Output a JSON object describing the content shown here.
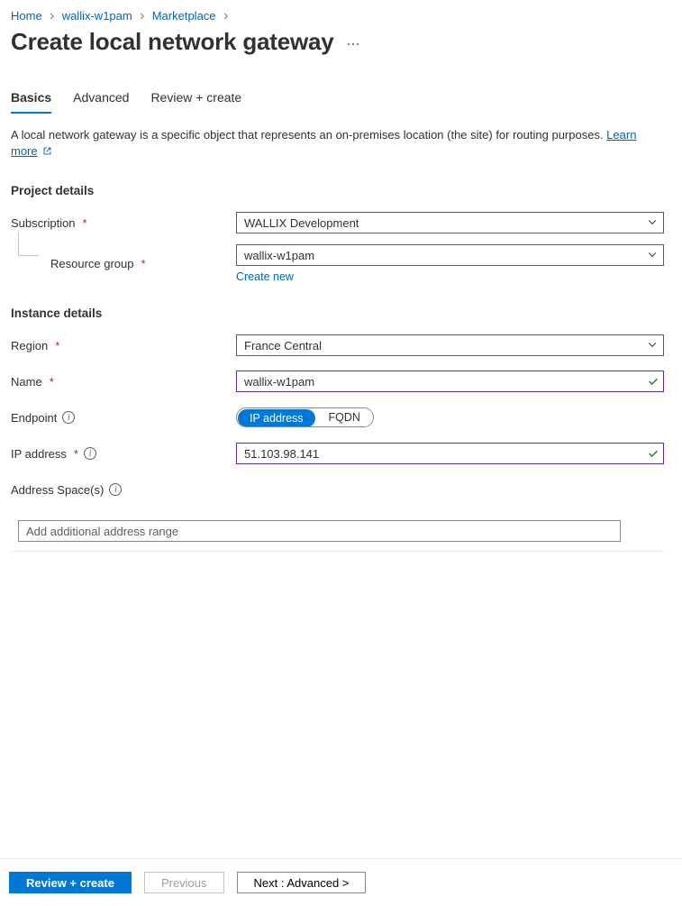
{
  "breadcrumb": [
    {
      "label": "Home"
    },
    {
      "label": "wallix-w1pam"
    },
    {
      "label": "Marketplace"
    }
  ],
  "page_title": "Create local network gateway",
  "tabs": {
    "basics": "Basics",
    "advanced": "Advanced",
    "review": "Review + create"
  },
  "description": {
    "text": "A local network gateway is a specific object that represents an on-premises location (the site) for routing purposes.  ",
    "learn_more": "Learn more"
  },
  "sections": {
    "project": "Project details",
    "instance": "Instance details"
  },
  "fields": {
    "subscription": {
      "label": "Subscription",
      "value": "WALLIX Development"
    },
    "resource_group": {
      "label": "Resource group",
      "value": "wallix-w1pam",
      "create_new": "Create new"
    },
    "region": {
      "label": "Region",
      "value": "France Central"
    },
    "name": {
      "label": "Name",
      "value": "wallix-w1pam"
    },
    "endpoint": {
      "label": "Endpoint",
      "options": {
        "ip": "IP address",
        "fqdn": "FQDN"
      }
    },
    "ip_address": {
      "label": "IP address",
      "value": "51.103.98.141"
    },
    "address_spaces": {
      "label": "Address Space(s)",
      "placeholder": "Add additional address range"
    }
  },
  "footer": {
    "review": "Review + create",
    "previous": "Previous",
    "next": "Next : Advanced >"
  }
}
